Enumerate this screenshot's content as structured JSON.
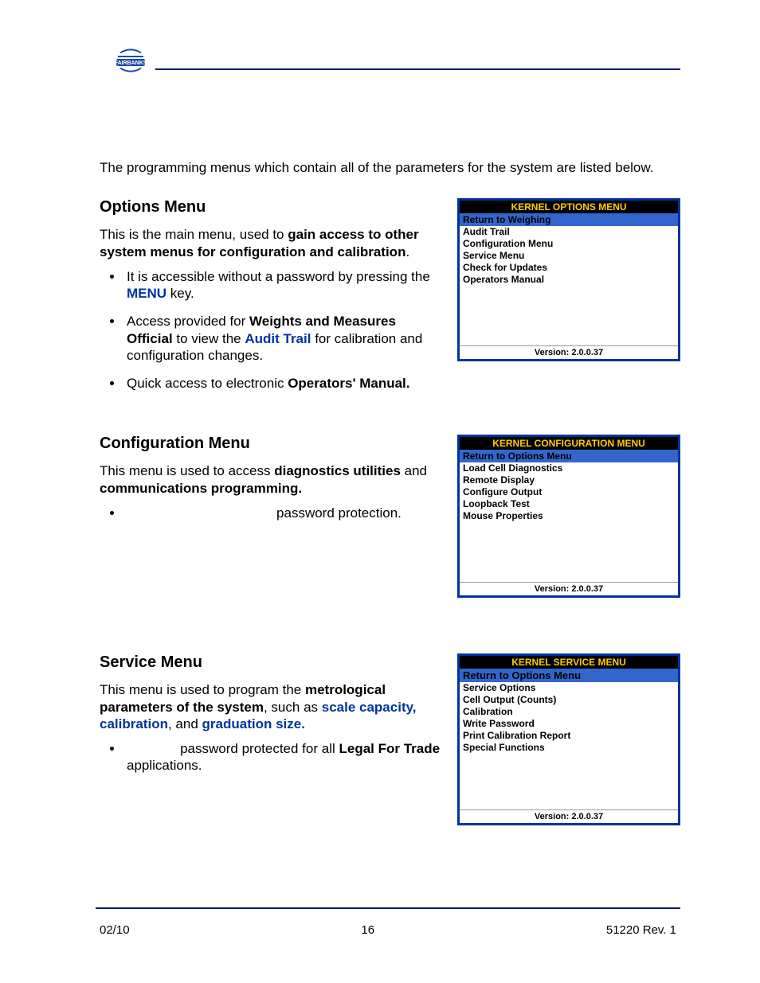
{
  "logo_text": "FAIRBANKS",
  "intro": "The programming menus which contain all of the parameters for the system are listed below.",
  "sections": {
    "options": {
      "heading": "Options Menu",
      "p1_a": "This is the main menu, used to ",
      "p1_b": "gain access to other system menus for configuration and calibration",
      "p1_c": ".",
      "li1_a": "It is accessible without a password by pressing the ",
      "li1_b": "MENU",
      "li1_c": " key.",
      "li2_a": "Access provided for ",
      "li2_b": "Weights and Measures Official",
      "li2_c": " to view the ",
      "li2_d": "Audit Trail",
      "li2_e": " for calibration and configuration changes.",
      "li3_a": "Quick access to electronic ",
      "li3_b": "Operators' Manual."
    },
    "config": {
      "heading": "Configuration Menu",
      "p1_a": "This menu is used to access ",
      "p1_b": "diagnostics utilities",
      "p1_c": " and ",
      "p1_d": "communications programming.",
      "li1": "password protection."
    },
    "service": {
      "heading": "Service Menu",
      "p1_a": "This menu is used to program the ",
      "p1_b": "metrological parameters of the system",
      "p1_c": ", such as ",
      "p1_d": "scale capacity, calibration",
      "p1_e": ", and ",
      "p1_f": "graduation size.",
      "li1_a": "password protected for all ",
      "li1_b": "Legal For Trade",
      "li1_c": " applications."
    }
  },
  "menus": {
    "options": {
      "title": "KERNEL OPTIONS MENU",
      "highlight": "Return to Weighing",
      "items": [
        "Audit Trail",
        "Configuration Menu",
        "Service Menu",
        "Check for Updates",
        "Operators Manual"
      ],
      "version": "Version: 2.0.0.37"
    },
    "config": {
      "title": "KERNEL CONFIGURATION MENU",
      "highlight": "Return to Options Menu",
      "items": [
        "Load Cell Diagnostics",
        "Remote Display",
        "Configure Output",
        "Loopback Test",
        "Mouse Properties"
      ],
      "version": "Version: 2.0.0.37"
    },
    "service": {
      "title": "KERNEL SERVICE MENU",
      "highlight": "Return to Options Menu",
      "items": [
        "Service Options",
        "Cell Output (Counts)",
        "Calibration",
        "Write Password",
        "Print Calibration Report",
        "Special Functions"
      ],
      "version": "Version: 2.0.0.37"
    }
  },
  "footer": {
    "left": "02/10",
    "center": "16",
    "right": "51220   Rev. 1"
  }
}
